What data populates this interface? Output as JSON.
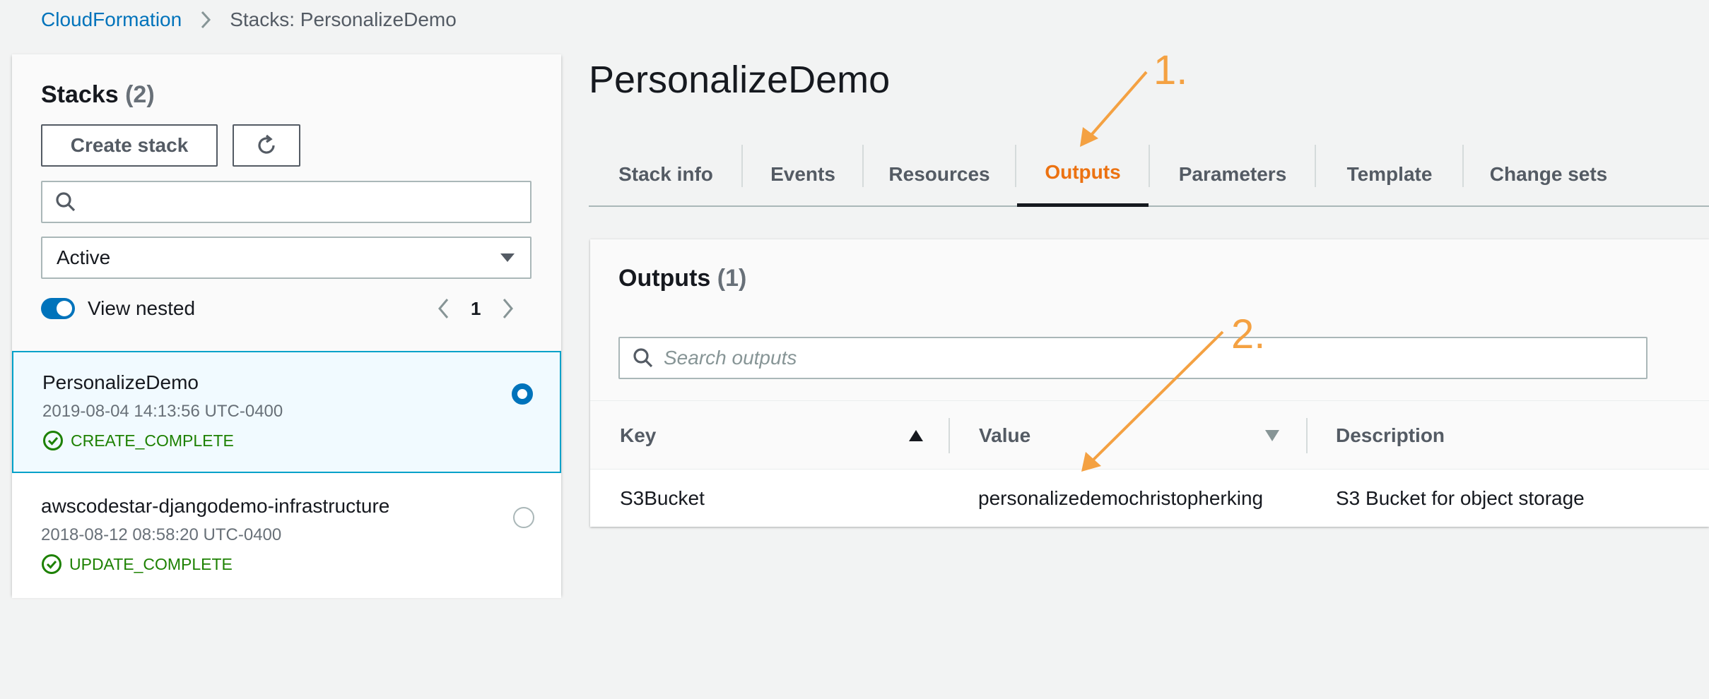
{
  "breadcrumb": {
    "root": "CloudFormation",
    "current": "Stacks: PersonalizeDemo"
  },
  "stacks_panel": {
    "title": "Stacks",
    "count": "(2)",
    "create_label": "Create stack",
    "search_placeholder": "",
    "filter_value": "Active",
    "view_nested_label": "View nested",
    "page_number": "1",
    "items": [
      {
        "name": "PersonalizeDemo",
        "date": "2019-08-04 14:13:56 UTC-0400",
        "status": "CREATE_COMPLETE",
        "selected": true
      },
      {
        "name": "awscodestar-djangodemo-infrastructure",
        "date": "2018-08-12 08:58:20 UTC-0400",
        "status": "UPDATE_COMPLETE",
        "selected": false
      }
    ]
  },
  "main": {
    "title": "PersonalizeDemo",
    "tabs": [
      {
        "label": "Stack info"
      },
      {
        "label": "Events"
      },
      {
        "label": "Resources"
      },
      {
        "label": "Outputs"
      },
      {
        "label": "Parameters"
      },
      {
        "label": "Template"
      },
      {
        "label": "Change sets"
      }
    ],
    "active_tab": "Outputs"
  },
  "outputs": {
    "title": "Outputs",
    "count": "(1)",
    "search_placeholder": "Search outputs",
    "columns": [
      "Key",
      "Value",
      "Description"
    ],
    "rows": [
      {
        "key": "S3Bucket",
        "value": "personalizedemochristopherking",
        "description": "S3 Bucket for object storage"
      }
    ]
  },
  "annotations": {
    "label_1": "1.",
    "label_2": "2."
  },
  "colors": {
    "accent_orange": "#ec7211",
    "link_blue": "#0073bb",
    "success_green": "#1d8102",
    "annotation": "#f4a142"
  }
}
